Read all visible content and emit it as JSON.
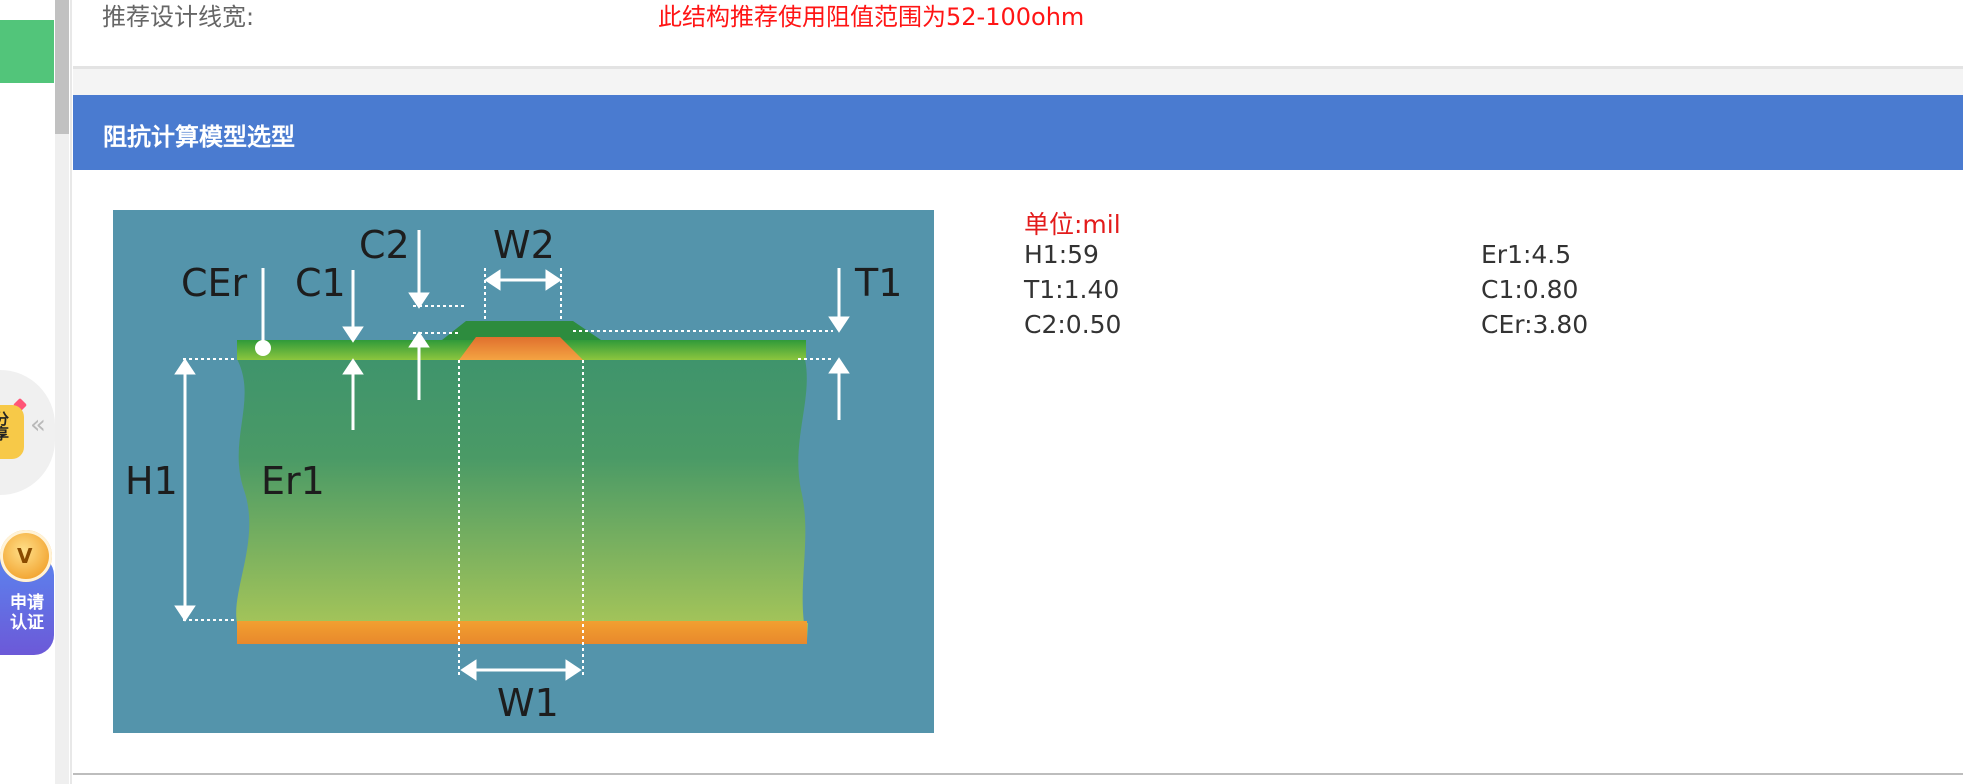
{
  "row": {
    "label": "推荐设计线宽:",
    "value": "此结构推荐使用阻值范围为52-100ohm"
  },
  "section": {
    "title": "阻抗计算模型选型"
  },
  "diagram": {
    "labels": {
      "c2": "C2",
      "w2": "W2",
      "cer": "CEr",
      "c1": "C1",
      "t1": "T1",
      "h1": "H1",
      "er1": "Er1",
      "w1": "W1"
    },
    "colors": {
      "background": "#5494ab",
      "substrate_top": "#3f946c",
      "substrate_bottom": "#acc858",
      "trace": "#f08a3c",
      "coating": "#6cae2b",
      "ground": "#f0a030"
    }
  },
  "params": {
    "unit": "单位:mil",
    "h1": "H1:59",
    "er1": "Er1:4.5",
    "t1": "T1:1.40",
    "c1": "C1:0.80",
    "c2": "C2:0.50",
    "cer": "CEr:3.80"
  },
  "sidebar": {
    "badge_text": "分享",
    "cert_label": "申请认证",
    "cert_icon_text": "V"
  },
  "colors": {
    "header": "#4a7bd0",
    "accent_red": "#ff1515"
  }
}
